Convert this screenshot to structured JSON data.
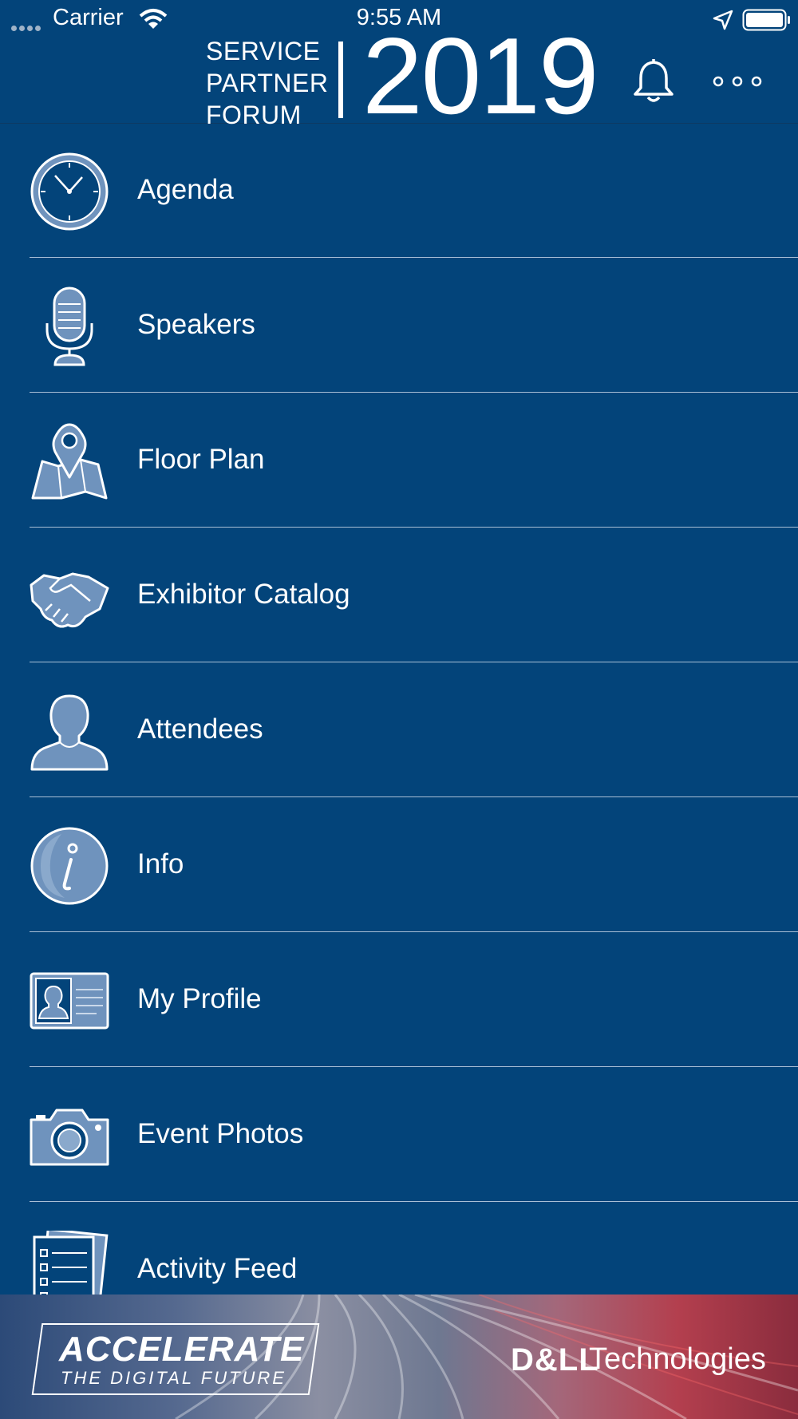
{
  "status_bar": {
    "carrier": "Carrier",
    "time": "9:55 AM"
  },
  "header": {
    "logo_words": [
      "SERVICE",
      "PARTNER",
      "FORUM"
    ],
    "logo_year": "2019",
    "notifications_icon": "bell-icon",
    "more_icon": "more-icon"
  },
  "menu": {
    "items": [
      {
        "label": "Agenda",
        "icon": "clock-icon"
      },
      {
        "label": "Speakers",
        "icon": "microphone-icon"
      },
      {
        "label": "Floor Plan",
        "icon": "map-pin-icon"
      },
      {
        "label": "Exhibitor Catalog",
        "icon": "handshake-icon"
      },
      {
        "label": "Attendees",
        "icon": "person-icon"
      },
      {
        "label": "Info",
        "icon": "info-icon"
      },
      {
        "label": "My Profile",
        "icon": "id-card-icon"
      },
      {
        "label": "Event Photos",
        "icon": "camera-icon"
      },
      {
        "label": "Activity Feed",
        "icon": "document-icon"
      }
    ]
  },
  "banner": {
    "title": "ACCELERATE",
    "subtitle": "THE DIGITAL FUTURE",
    "brand_dell": "D&LL",
    "brand_tech": "Technologies"
  },
  "colors": {
    "background": "#03447a",
    "icon_fill": "#6f93bd",
    "divider": "#a9bfd6"
  }
}
